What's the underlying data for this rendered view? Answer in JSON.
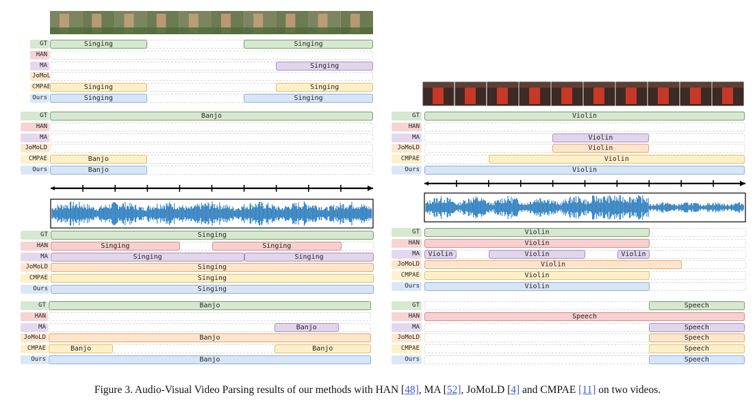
{
  "colors": {
    "GT": {
      "fill": "#d6e8d0",
      "border": "#7a9a6d",
      "label": "#d6e8d0"
    },
    "HAN": {
      "fill": "#f6cfcf",
      "border": "#d98c8c",
      "label": "#f6d4d4"
    },
    "MA": {
      "fill": "#e1d5ea",
      "border": "#a98dc4",
      "label": "#e4d8ee"
    },
    "JoMoLD": {
      "fill": "#fde4cc",
      "border": "#e3a867",
      "label": "#fde6ce"
    },
    "CMPAE": {
      "fill": "#fcefc9",
      "border": "#e0c06a",
      "label": "#fdf0cc"
    },
    "Ours": {
      "fill": "#d7e5f6",
      "border": "#8fb0d9",
      "label": "#d9e7f7"
    }
  },
  "methods": [
    "GT",
    "HAN",
    "MA",
    "JoMoLD",
    "CMPAE",
    "Ours"
  ],
  "groups": [
    {
      "id": "left-visual-singing",
      "rows": [
        {
          "method": "GT",
          "segments": [
            {
              "start": 0,
              "end": 3,
              "label": "Singing"
            },
            {
              "start": 6,
              "end": 10,
              "label": "Singing"
            }
          ]
        },
        {
          "method": "HAN",
          "segments": []
        },
        {
          "method": "MA",
          "segments": [
            {
              "start": 7,
              "end": 10,
              "label": "Singing"
            }
          ]
        },
        {
          "method": "JoMoLD",
          "segments": []
        },
        {
          "method": "CMPAE",
          "segments": [
            {
              "start": 0,
              "end": 3,
              "label": "Singing"
            },
            {
              "start": 7,
              "end": 10,
              "label": "Singing"
            }
          ]
        },
        {
          "method": "Ours",
          "segments": [
            {
              "start": 0,
              "end": 3,
              "label": "Singing"
            },
            {
              "start": 6,
              "end": 10,
              "label": "Singing"
            }
          ]
        }
      ]
    },
    {
      "id": "left-visual-banjo",
      "rows": [
        {
          "method": "GT",
          "segments": [
            {
              "start": 0,
              "end": 10,
              "label": "Banjo"
            }
          ]
        },
        {
          "method": "HAN",
          "segments": []
        },
        {
          "method": "MA",
          "segments": []
        },
        {
          "method": "JoMoLD",
          "segments": []
        },
        {
          "method": "CMPAE",
          "segments": [
            {
              "start": 0,
              "end": 3,
              "label": "Banjo"
            }
          ]
        },
        {
          "method": "Ours",
          "segments": [
            {
              "start": 0,
              "end": 3,
              "label": "Banjo"
            }
          ]
        }
      ]
    },
    {
      "id": "left-audio-singing",
      "rows": [
        {
          "method": "GT",
          "segments": [
            {
              "start": 0,
              "end": 10,
              "label": "Singing"
            }
          ]
        },
        {
          "method": "HAN",
          "segments": [
            {
              "start": 0,
              "end": 4,
              "label": "Singing"
            },
            {
              "start": 5,
              "end": 9,
              "label": "Singing"
            }
          ]
        },
        {
          "method": "MA",
          "segments": [
            {
              "start": 0,
              "end": 6,
              "label": "Singing"
            },
            {
              "start": 6,
              "end": 10,
              "label": "Singing"
            }
          ]
        },
        {
          "method": "JoMoLD",
          "segments": [
            {
              "start": 0,
              "end": 10,
              "label": "Singing"
            }
          ]
        },
        {
          "method": "CMPAE",
          "segments": [
            {
              "start": 0,
              "end": 10,
              "label": "Singing"
            }
          ]
        },
        {
          "method": "Ours",
          "segments": [
            {
              "start": 0,
              "end": 10,
              "label": "Singing"
            }
          ]
        }
      ]
    },
    {
      "id": "left-audio-banjo",
      "rows": [
        {
          "method": "GT",
          "segments": [
            {
              "start": 0,
              "end": 10,
              "label": "Banjo"
            }
          ]
        },
        {
          "method": "HAN",
          "segments": []
        },
        {
          "method": "MA",
          "segments": [
            {
              "start": 7,
              "end": 9,
              "label": "Banjo"
            }
          ]
        },
        {
          "method": "JoMoLD",
          "segments": [
            {
              "start": 0,
              "end": 10,
              "label": "Banjo"
            }
          ]
        },
        {
          "method": "CMPAE",
          "segments": [
            {
              "start": 0,
              "end": 2,
              "label": "Banjo"
            },
            {
              "start": 7,
              "end": 10,
              "label": "Banjo"
            }
          ]
        },
        {
          "method": "Ours",
          "segments": [
            {
              "start": 0,
              "end": 10,
              "label": "Banjo"
            }
          ]
        }
      ]
    },
    {
      "id": "right-visual-violin",
      "rows": [
        {
          "method": "GT",
          "segments": [
            {
              "start": 0,
              "end": 10,
              "label": "Violin"
            }
          ]
        },
        {
          "method": "HAN",
          "segments": []
        },
        {
          "method": "MA",
          "segments": [
            {
              "start": 4,
              "end": 7,
              "label": "Violin"
            }
          ]
        },
        {
          "method": "JoMoLD",
          "segments": [
            {
              "start": 4,
              "end": 7,
              "label": "Violin"
            }
          ]
        },
        {
          "method": "CMPAE",
          "segments": [
            {
              "start": 2,
              "end": 10,
              "label": "Violin"
            }
          ]
        },
        {
          "method": "Ours",
          "segments": [
            {
              "start": 0,
              "end": 10,
              "label": "Violin"
            }
          ]
        }
      ]
    },
    {
      "id": "right-audio-violin",
      "rows": [
        {
          "method": "GT",
          "segments": [
            {
              "start": 0,
              "end": 7,
              "label": "Violin"
            }
          ]
        },
        {
          "method": "HAN",
          "segments": [
            {
              "start": 0,
              "end": 7,
              "label": "Violin"
            }
          ]
        },
        {
          "method": "MA",
          "segments": [
            {
              "start": 0,
              "end": 1,
              "label": "Violin"
            },
            {
              "start": 2,
              "end": 5,
              "label": "Violin"
            },
            {
              "start": 6,
              "end": 7,
              "label": "Violin"
            }
          ]
        },
        {
          "method": "JoMoLD",
          "segments": [
            {
              "start": 0,
              "end": 8,
              "label": "Violin"
            }
          ]
        },
        {
          "method": "CMPAE",
          "segments": [
            {
              "start": 0,
              "end": 7,
              "label": "Violin"
            }
          ]
        },
        {
          "method": "Ours",
          "segments": [
            {
              "start": 0,
              "end": 7,
              "label": "Violin"
            }
          ]
        }
      ]
    },
    {
      "id": "right-audio-speech",
      "rows": [
        {
          "method": "GT",
          "segments": [
            {
              "start": 7,
              "end": 10,
              "label": "Speech"
            }
          ]
        },
        {
          "method": "HAN",
          "segments": [
            {
              "start": 0,
              "end": 10,
              "label": "Speech"
            }
          ]
        },
        {
          "method": "MA",
          "segments": [
            {
              "start": 7,
              "end": 10,
              "label": "Speech"
            }
          ]
        },
        {
          "method": "JoMoLD",
          "segments": [
            {
              "start": 7,
              "end": 10,
              "label": "Speech"
            }
          ]
        },
        {
          "method": "CMPAE",
          "segments": [
            {
              "start": 7,
              "end": 10,
              "label": "Speech"
            }
          ]
        },
        {
          "method": "Ours",
          "segments": [
            {
              "start": 7,
              "end": 10,
              "label": "Speech"
            }
          ]
        }
      ]
    }
  ],
  "caption": {
    "prefix": "Figure 3. Audio-Visual Video Parsing results of our methods with HAN [",
    "ref1": "48]",
    "mid1": ", MA [",
    "ref2": "52]",
    "mid2": ", JoMoLD [",
    "ref3": "4]",
    "mid3": " and CMPAE ",
    "ref4": "[11]",
    "suffix": " on two videos."
  }
}
